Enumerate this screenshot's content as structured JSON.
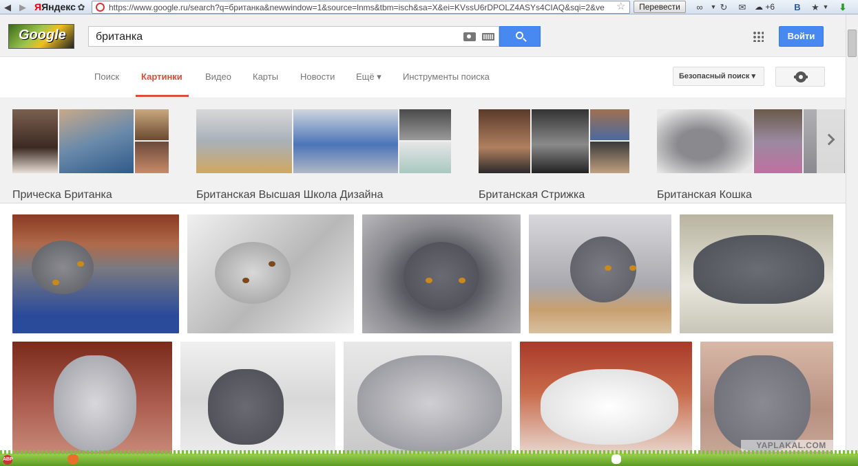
{
  "browser": {
    "brand": "Яндекс",
    "url": "https://www.google.ru/search?q=британка&newwindow=1&source=lnms&tbm=isch&sa=X&ei=KVssU6rDPOLZ4ASYs4CIAQ&sqi=2&ve",
    "translate_label": "Перевести",
    "weather_text": "+6"
  },
  "header": {
    "logo_text": "Google",
    "query": "британка",
    "signin_label": "Войти"
  },
  "tabs": [
    {
      "label": "Поиск"
    },
    {
      "label": "Картинки"
    },
    {
      "label": "Видео"
    },
    {
      "label": "Карты"
    },
    {
      "label": "Новости"
    },
    {
      "label": "Ещё ▾"
    },
    {
      "label": "Инструменты поиска"
    }
  ],
  "safesearch_label": "Безопасный поиск ▾",
  "related": [
    {
      "label": "Прическа Британка"
    },
    {
      "label": "Британская Высшая Школа Дизайна"
    },
    {
      "label": "Британская Стрижка"
    },
    {
      "label": "Британская Кошка"
    }
  ],
  "watermark": "YAPLAKAL.COM",
  "colors": {
    "accent_red": "#dd4b39",
    "button_blue": "#4889f1"
  }
}
